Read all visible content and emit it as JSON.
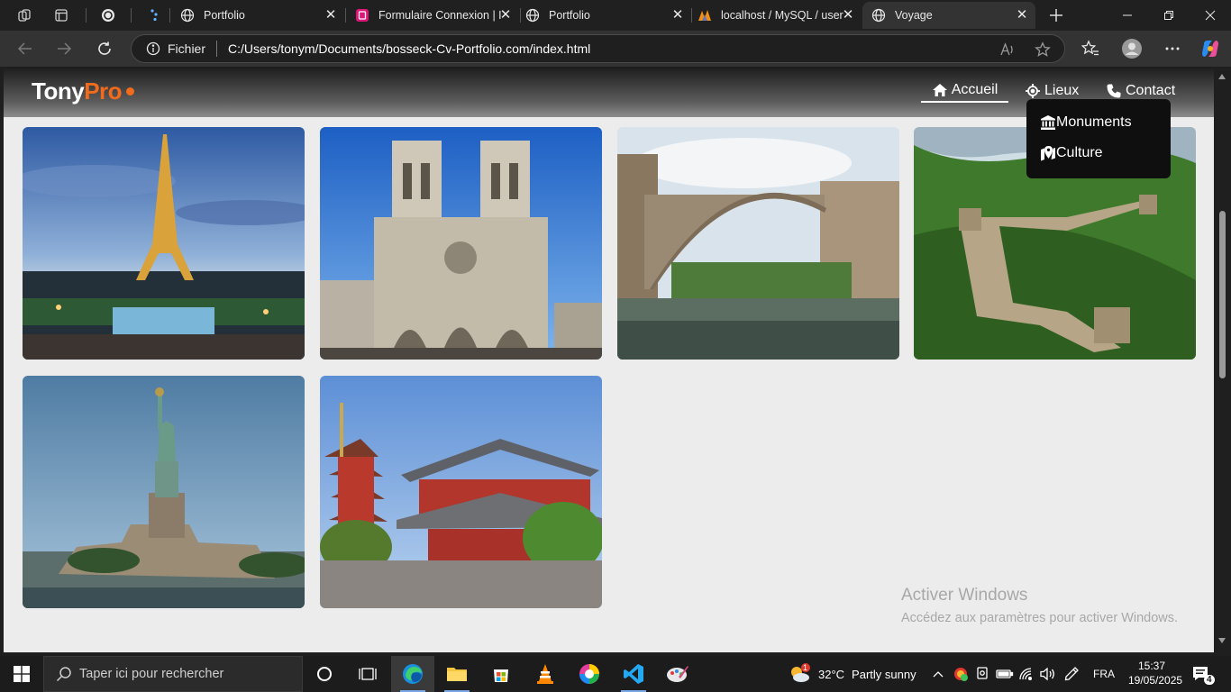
{
  "browser": {
    "tabs": [
      {
        "title": "Portfolio",
        "icon": "globe-icon"
      },
      {
        "title": "Formulaire Connexion | I",
        "icon": "formulaire-site-icon"
      },
      {
        "title": "Portfolio",
        "icon": "globe-icon"
      },
      {
        "title": "localhost / MySQL / user",
        "icon": "phpmyadmin-icon"
      },
      {
        "title": "Voyage",
        "icon": "globe-icon",
        "active": true
      }
    ],
    "address": {
      "scheme_label": "Fichier",
      "url": "C:/Users/tonym/Documents/bosseck-Cv-Portfolio.com/index.html"
    }
  },
  "site": {
    "logo": {
      "part1": "Tony",
      "part2": "Pro"
    },
    "nav": [
      {
        "label": "Accueil",
        "icon": "home-icon",
        "current": true
      },
      {
        "label": "Lieux",
        "icon": "location-icon"
      },
      {
        "label": "Contact",
        "icon": "phone-icon"
      }
    ],
    "dropdown": [
      {
        "label": "Monuments",
        "icon": "landmark-icon"
      },
      {
        "label": "Culture",
        "icon": "map-marker-icon"
      }
    ],
    "gallery": [
      {
        "name": "eiffel-tower-photo"
      },
      {
        "name": "notre-dame-photo"
      },
      {
        "name": "mostar-bridge-photo"
      },
      {
        "name": "great-wall-photo"
      },
      {
        "name": "statue-of-liberty-photo"
      },
      {
        "name": "sensoji-temple-photo"
      }
    ]
  },
  "watermark": {
    "title": "Activer Windows",
    "subtitle": "Accédez aux paramètres pour activer Windows."
  },
  "taskbar": {
    "search_placeholder": "Taper ici pour rechercher",
    "weather": {
      "temp": "32°C",
      "condition": "Partly sunny",
      "badge": "1"
    },
    "language": "FRA",
    "time": "15:37",
    "date": "19/05/2025",
    "notifications": "4"
  },
  "colors": {
    "brand_orange": "#f26a1b",
    "tab_active": "#333333",
    "page_bg": "#ececec"
  }
}
